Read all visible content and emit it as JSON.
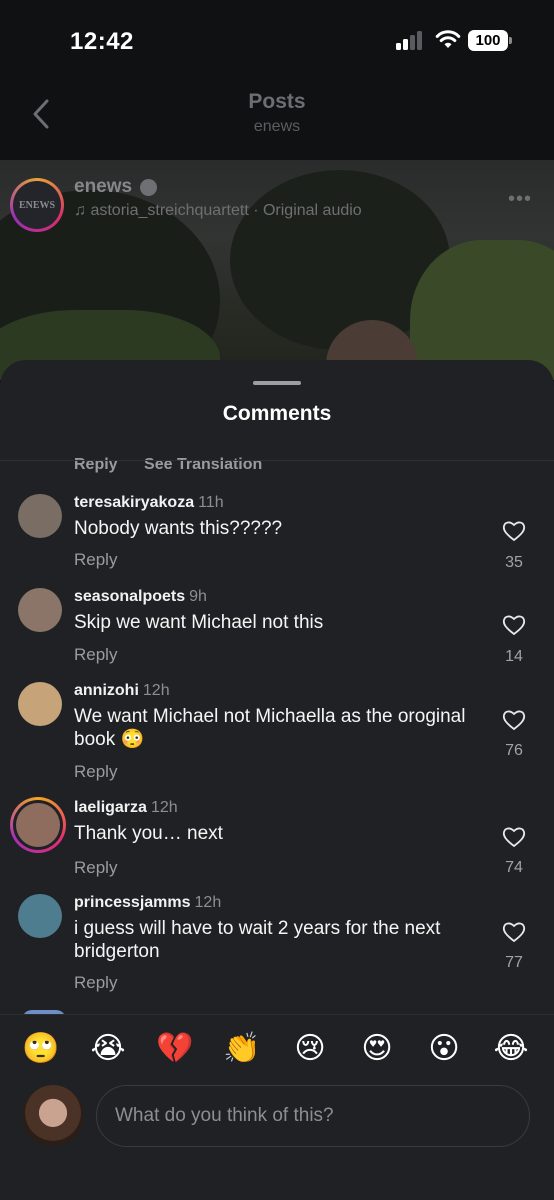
{
  "status_bar": {
    "time": "12:42",
    "battery": "100"
  },
  "nav": {
    "title": "Posts",
    "subtitle": "enews"
  },
  "post": {
    "avatar_text": "ENEWS",
    "username": "enews",
    "audio": "astoria_streichquartett · Original audio",
    "more": "•••"
  },
  "sheet": {
    "title": "Comments",
    "top_reply": "Reply",
    "top_translation": "See Translation"
  },
  "comments": [
    {
      "username": "teresakiryakoza",
      "time": "11h",
      "text": "Nobody wants this?????",
      "reply": "Reply",
      "likes": "35",
      "avatar_color": "#7a6d64"
    },
    {
      "username": "seasonalpoets",
      "time": "9h",
      "text": "Skip we want Michael not this",
      "reply": "Reply",
      "likes": "14",
      "avatar_color": "#8a7568"
    },
    {
      "username": "annizohi",
      "time": "12h",
      "text": "We want Michael not Michaella as the oroginal book 😳",
      "reply": "Reply",
      "likes": "76",
      "avatar_color": "#c7a37a"
    },
    {
      "username": "laeligarza",
      "time": "12h",
      "text": "Thank you… next",
      "reply": "Reply",
      "likes": "74",
      "avatar_color": "#8e6d5e"
    },
    {
      "username": "princessjamms",
      "time": "12h",
      "text": "i guess will have to wait 2 years for the next bridgerton",
      "reply": "Reply",
      "likes": "77",
      "avatar_color": "#4e7d8f"
    }
  ],
  "emojis": [
    "🙄",
    "😭",
    "💔",
    "👏",
    "😢",
    "😍",
    "😮",
    "😂"
  ],
  "composer": {
    "placeholder": "What do you think of this?"
  },
  "colors": {
    "sheet_bg": "#202124",
    "story_ring": "#e62e6f"
  }
}
